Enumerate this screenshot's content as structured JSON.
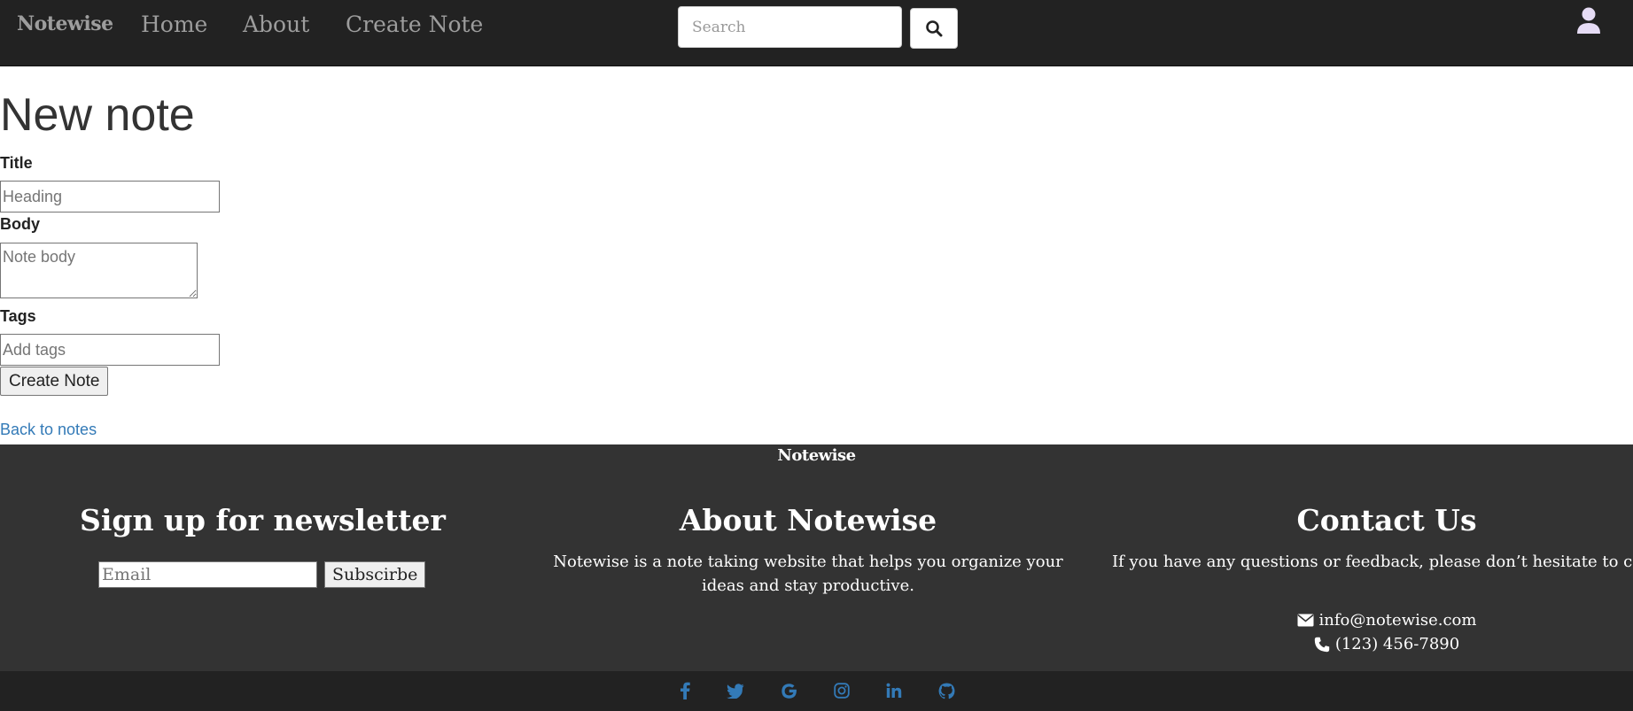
{
  "navbar": {
    "brand": "Notewise",
    "links": {
      "home": "Home",
      "about": "About",
      "create_note": "Create Note"
    },
    "search": {
      "placeholder": "Search",
      "value": ""
    },
    "search_button_icon": "search-icon",
    "user_icon": "user-icon"
  },
  "form": {
    "heading": "New note",
    "title_label": "Title",
    "title_placeholder": "Heading",
    "body_label": "Body",
    "body_placeholder": "Note body",
    "tags_label": "Tags",
    "tags_placeholder": "Add tags",
    "submit_label": "Create Note",
    "back_link": "Back to notes"
  },
  "footer": {
    "brand": "Notewise",
    "newsletter": {
      "heading": "Sign up for newsletter",
      "email_placeholder": "Email",
      "subscribe_label": "Subscirbe"
    },
    "about": {
      "heading": "About Notewise",
      "text": "Notewise is a note taking website that helps you organize your ideas and stay productive."
    },
    "contact": {
      "heading": "Contact Us",
      "text": "If you have any questions or feedback, please don’t hesitate to contact us.",
      "email": "info@notewise.com",
      "phone": "(123) 456-7890"
    },
    "social_icons": [
      "facebook-icon",
      "twitter-icon",
      "google-icon",
      "instagram-icon",
      "linkedin-icon",
      "github-icon"
    ]
  },
  "colors": {
    "navbar_bg": "#222222",
    "footer_bg": "#333333",
    "link_blue": "#337ab7",
    "nav_text": "#9d9d9d",
    "user_icon": "#e6dcf5"
  }
}
